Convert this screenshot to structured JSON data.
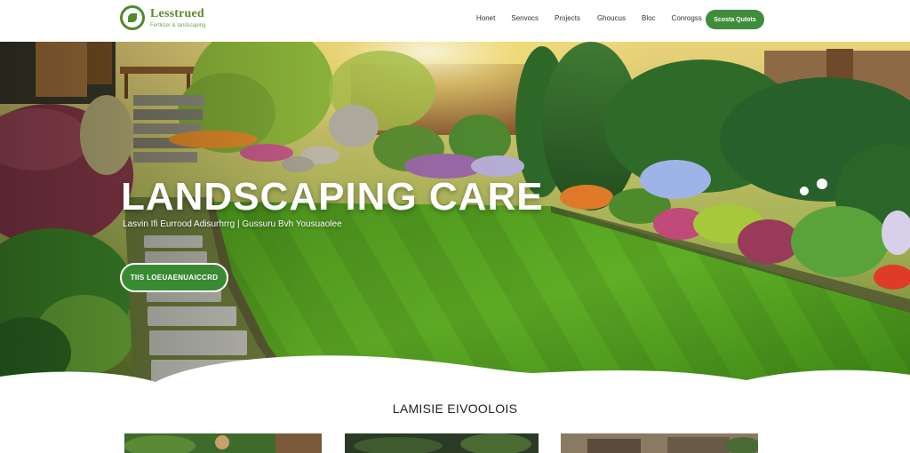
{
  "header": {
    "logo_name": "Lesstrued",
    "logo_tagline": "Fertilizer & landscaping",
    "nav": [
      "Honet",
      "Senvocs",
      "Projects",
      "Ghoucus",
      "Bloc",
      "Conrogss"
    ],
    "cta_label": "Scosta Qutots"
  },
  "hero": {
    "title": "LANDSCAPING CARE",
    "subtitle": "Lasvin Ifi Eurrood Adisurhrrg | Gussuru Bvh Yousuaolee",
    "button_label": "TIIS LOEUAENUAICCRD"
  },
  "section": {
    "title": "LAMISIE EIVOOLOIS"
  },
  "colors": {
    "brand_green": "#3f8d3a",
    "logo_green": "#5a8c2b"
  }
}
